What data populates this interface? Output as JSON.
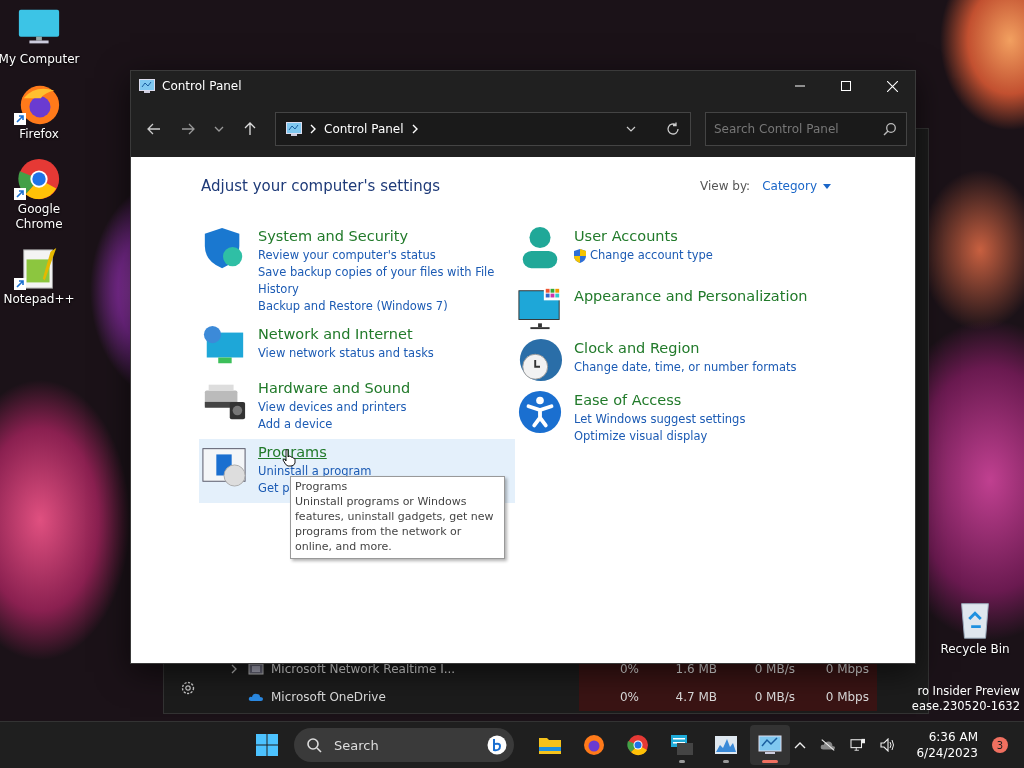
{
  "desktop_icons": [
    {
      "kind": "monitor",
      "label": "My Computer",
      "shortcut": false
    },
    {
      "kind": "firefox",
      "label": "Firefox",
      "shortcut": true
    },
    {
      "kind": "chrome",
      "label": "Google Chrome",
      "shortcut": true
    },
    {
      "kind": "notepad",
      "label": "Notepad++",
      "shortcut": true
    }
  ],
  "recycle_bin": {
    "label": "Recycle Bin"
  },
  "os_watermark": [
    "ro Insider Preview",
    "ease.230520-1632"
  ],
  "background_window": {
    "rows": [
      {
        "kind": "app",
        "expandable": true,
        "name": "Microsoft Network Realtime I...",
        "cpu": "0%",
        "memory": "1.6 MB",
        "disk": "0 MB/s",
        "network": "0 Mbps"
      },
      {
        "kind": "cloud",
        "expandable": false,
        "name": "Microsoft OneDrive",
        "cpu": "0%",
        "memory": "4.7 MB",
        "disk": "0 MB/s",
        "network": "0 Mbps"
      }
    ]
  },
  "window": {
    "title": "Control Panel",
    "address": [
      "Control Panel"
    ],
    "search": {
      "placeholder": "Search Control Panel"
    },
    "heading": "Adjust your computer's settings",
    "view_by": {
      "label": "View by:",
      "value": "Category"
    },
    "columns": [
      [
        {
          "kind": "security",
          "title": "System and Security",
          "selected": false,
          "links": [
            {
              "text": "Review your computer's status",
              "shield": false
            },
            {
              "text": "Save backup copies of your files with File History",
              "shield": false
            },
            {
              "text": "Backup and Restore (Windows 7)",
              "shield": false
            }
          ]
        },
        {
          "kind": "network",
          "title": "Network and Internet",
          "selected": false,
          "links": [
            {
              "text": "View network status and tasks",
              "shield": false
            }
          ]
        },
        {
          "kind": "hardware",
          "title": "Hardware and Sound",
          "selected": false,
          "links": [
            {
              "text": "View devices and printers",
              "shield": false
            },
            {
              "text": "Add a device",
              "shield": false
            }
          ]
        },
        {
          "kind": "programs",
          "title": "Programs",
          "selected": true,
          "links": [
            {
              "text": "Uninstall a program",
              "shield": false
            },
            {
              "text": "Get p",
              "shield": false
            }
          ]
        }
      ],
      [
        {
          "kind": "user",
          "title": "User Accounts",
          "selected": false,
          "links": [
            {
              "text": "Change account type",
              "shield": true
            }
          ]
        },
        {
          "kind": "appearance",
          "title": "Appearance and Personalization",
          "selected": false
        },
        {
          "kind": "clock",
          "title": "Clock and Region",
          "selected": false,
          "links": [
            {
              "text": "Change date, time, or number formats",
              "shield": false
            }
          ]
        },
        {
          "kind": "access",
          "title": "Ease of Access",
          "selected": false,
          "links": [
            {
              "text": "Let Windows suggest settings",
              "shield": false
            },
            {
              "text": "Optimize visual display",
              "shield": false
            }
          ]
        }
      ]
    ],
    "tooltip": {
      "title": "Programs",
      "text": "Uninstall programs or Windows features, uninstall gadgets, get new programs from the network or online, and more."
    }
  },
  "taskbar": {
    "search": {
      "placeholder": "Search"
    },
    "apps": [
      {
        "kind": "explorer",
        "running": false,
        "active": false
      },
      {
        "kind": "firefox",
        "running": false,
        "active": false
      },
      {
        "kind": "chrome",
        "running": false,
        "active": false
      },
      {
        "kind": "keyboard",
        "running": true,
        "active": false
      },
      {
        "kind": "chart",
        "running": true,
        "active": false
      },
      {
        "kind": "control-panel",
        "running": true,
        "active": true
      }
    ],
    "time": "6:36 AM",
    "date": "6/24/2023",
    "notification_count": "3"
  }
}
